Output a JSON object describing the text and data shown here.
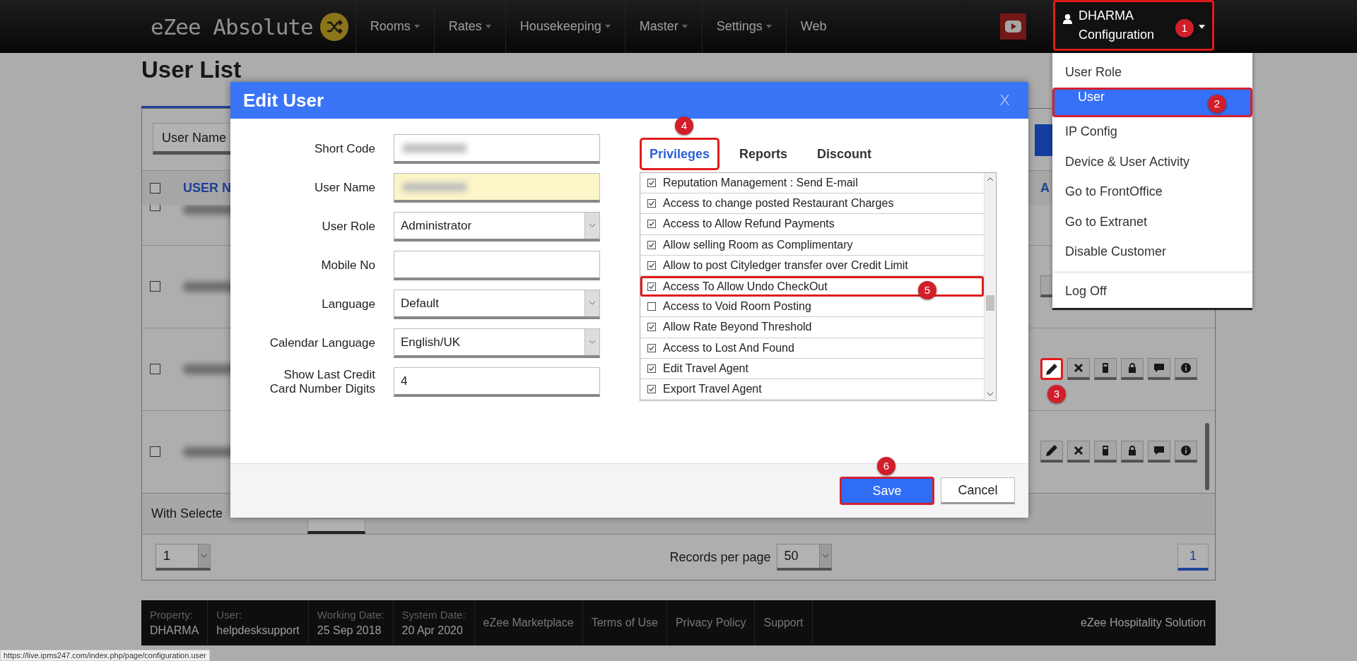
{
  "nav": {
    "logo": "eZee Absolute",
    "menu": [
      {
        "label": "Rooms",
        "has_menu": true
      },
      {
        "label": "Rates",
        "has_menu": true
      },
      {
        "label": "Housekeeping",
        "has_menu": true
      },
      {
        "label": "Master",
        "has_menu": true
      },
      {
        "label": "Settings",
        "has_menu": true
      },
      {
        "label": "Web",
        "has_menu": false
      }
    ],
    "user": {
      "name": "DHARMA",
      "subtitle": "Configuration",
      "badge": "1"
    }
  },
  "user_menu": {
    "items": [
      {
        "label": "User Role",
        "selected": false
      },
      {
        "label": "User",
        "selected": true,
        "badge": "2"
      },
      {
        "label": "IP Config",
        "selected": false
      },
      {
        "label": "Device & User Activity",
        "selected": false
      },
      {
        "label": "Go to FrontOffice",
        "selected": false
      },
      {
        "label": "Go to Extranet",
        "selected": false
      },
      {
        "label": "Disable Customer",
        "selected": false
      }
    ],
    "bottom_items": [
      {
        "label": "Log Off",
        "selected": false
      }
    ]
  },
  "page": {
    "title": "User List",
    "filter": "User Name",
    "all_checked": false,
    "columns": [
      "USER N",
      "A"
    ],
    "rows": [
      {
        "checked": false,
        "kind": "none"
      },
      {
        "checked": false,
        "kind": "edit"
      },
      {
        "checked": false,
        "kind": "full",
        "highlighted": true,
        "badge": "3"
      },
      {
        "checked": false,
        "kind": "full",
        "highlighted": false
      }
    ],
    "bulk_label": "With Selecte",
    "page_select": "1",
    "records_label": "Records per page",
    "records_value": "50",
    "current_page": "1"
  },
  "modal": {
    "title": "Edit User",
    "close": "X",
    "fields": [
      {
        "label": "Short Code",
        "kind": "blurred",
        "autofill": false
      },
      {
        "label": "User Name",
        "kind": "blurred",
        "autofill": true
      },
      {
        "label": "User Role",
        "kind": "select",
        "value": "Administrator"
      },
      {
        "label": "Mobile No",
        "kind": "text"
      },
      {
        "label": "Language",
        "kind": "select",
        "value": "Default"
      },
      {
        "label": "Calendar Language",
        "kind": "select",
        "value": "English/UK"
      },
      {
        "label": "Show Last Credit Card Number Digits",
        "kind": "text",
        "value": "4"
      }
    ],
    "tabs": [
      {
        "label": "Privileges",
        "selected": true,
        "badge": "4"
      },
      {
        "label": "Reports",
        "selected": false
      },
      {
        "label": "Discount",
        "selected": false
      }
    ],
    "privileges": [
      {
        "label": "Reputation Management : Send E-mail",
        "checked": true,
        "highlighted": false
      },
      {
        "label": "Access to change posted Restaurant Charges",
        "checked": true,
        "highlighted": false
      },
      {
        "label": "Access to Allow Refund Payments",
        "checked": true,
        "highlighted": false
      },
      {
        "label": "Allow selling Room as Complimentary",
        "checked": true,
        "highlighted": false
      },
      {
        "label": "Allow to post Cityledger transfer over Credit Limit",
        "checked": true,
        "highlighted": false
      },
      {
        "label": "Access To Allow Undo CheckOut",
        "checked": true,
        "highlighted": true,
        "badge": "5"
      },
      {
        "label": "Access to Void Room Posting",
        "checked": false,
        "highlighted": false
      },
      {
        "label": "Allow Rate Beyond Threshold",
        "checked": true,
        "highlighted": false
      },
      {
        "label": "Access to Lost And Found",
        "checked": true,
        "highlighted": false
      },
      {
        "label": "Edit Travel Agent",
        "checked": true,
        "highlighted": false
      },
      {
        "label": "Export Travel Agent",
        "checked": true,
        "highlighted": false
      }
    ],
    "save": {
      "label": "Save",
      "badge": "6"
    },
    "cancel": "Cancel"
  },
  "footer": {
    "info": [
      {
        "label": "Property:",
        "value": "DHARMA"
      },
      {
        "label": "User:",
        "value": "helpdesksupport"
      },
      {
        "label": "Working Date:",
        "value": "25 Sep 2018"
      },
      {
        "label": "System Date:",
        "value": "20 Apr 2020"
      }
    ],
    "links": [
      "eZee Marketplace",
      "Terms of Use",
      "Privacy Policy",
      "Support"
    ],
    "brand": "eZee Hospitality Solution"
  },
  "status_url": "https://live.ipms247.com/index.php/page/configuration.user"
}
